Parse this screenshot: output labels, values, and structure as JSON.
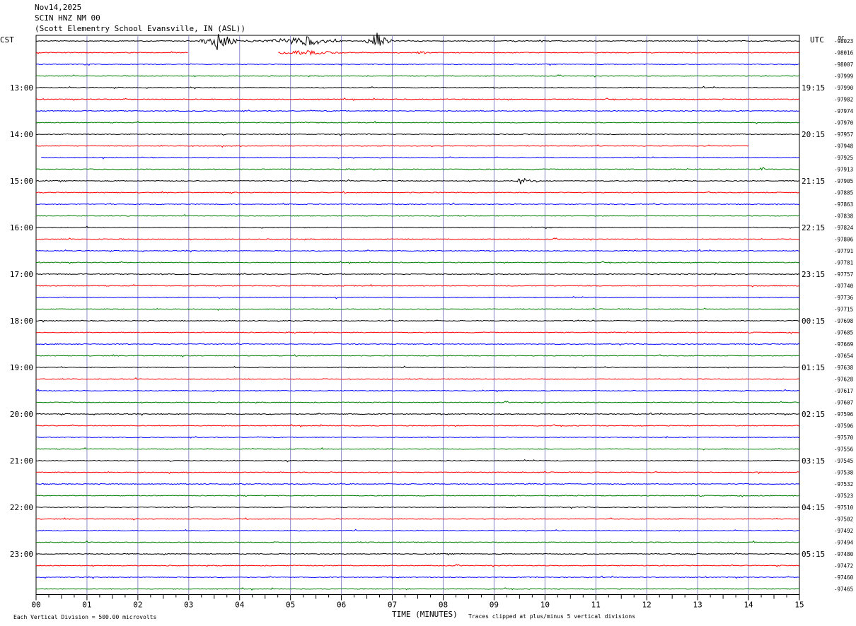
{
  "header": {
    "date": "Nov14,2025",
    "station": "SCIN HNZ NM 00",
    "location": "(Scott Elementry School Evansville, IN (ASL))"
  },
  "footer": {
    "scale_note": "Each Vertical Division =  500.00 microvolts",
    "clip_note": "Traces clipped at plus/minus 5 vertical divisions"
  },
  "chart_data": {
    "type": "line",
    "title": "",
    "xlabel": "TIME (MINUTES)",
    "ylabel": "",
    "xlim": [
      0,
      15
    ],
    "x_ticks": [
      "00",
      "01",
      "02",
      "03",
      "04",
      "05",
      "06",
      "07",
      "08",
      "09",
      "10",
      "11",
      "12",
      "13",
      "14",
      "15"
    ],
    "left_axis_title": "CST",
    "right_axis_title": "UTC",
    "dc_label": "DC",
    "left_time_labels": [
      {
        "row": 4,
        "label": "13:00"
      },
      {
        "row": 8,
        "label": "14:00"
      },
      {
        "row": 12,
        "label": "15:00"
      },
      {
        "row": 16,
        "label": "16:00"
      },
      {
        "row": 20,
        "label": "17:00"
      },
      {
        "row": 24,
        "label": "18:00"
      },
      {
        "row": 28,
        "label": "19:00"
      },
      {
        "row": 32,
        "label": "20:00"
      },
      {
        "row": 36,
        "label": "21:00"
      },
      {
        "row": 40,
        "label": "22:00"
      },
      {
        "row": 44,
        "label": "23:00"
      }
    ],
    "right_time_labels": [
      {
        "row": 4,
        "label": "19:15"
      },
      {
        "row": 8,
        "label": "20:15"
      },
      {
        "row": 12,
        "label": "21:15"
      },
      {
        "row": 16,
        "label": "22:15"
      },
      {
        "row": 20,
        "label": "23:15"
      },
      {
        "row": 24,
        "label": "00:15"
      },
      {
        "row": 28,
        "label": "01:15"
      },
      {
        "row": 32,
        "label": "02:15"
      },
      {
        "row": 36,
        "label": "03:15"
      },
      {
        "row": 40,
        "label": "04:15"
      },
      {
        "row": 44,
        "label": "05:15"
      }
    ],
    "trace_colors": [
      "#000000",
      "#ff0000",
      "#0000ff",
      "#008000"
    ],
    "grid_color": "#8c8cc8",
    "dc_offsets": [
      "-98023",
      "-98016",
      "-98007",
      "-97999",
      "-97990",
      "-97982",
      "-97974",
      "-97970",
      "-97957",
      "-97948",
      "-97925",
      "-97913",
      "-97905",
      "-97885",
      "-97863",
      "-97838",
      "-97824",
      "-97806",
      "-97791",
      "-97781",
      "-97757",
      "-97740",
      "-97736",
      "-97715",
      "-97698",
      "-97685",
      "-97669",
      "-97654",
      "-97638",
      "-97628",
      "-97617",
      "-97607",
      "-97596",
      "-97596",
      "-97570",
      "-97556",
      "-97545",
      "-97538",
      "-97532",
      "-97523",
      "-97510",
      "-97502",
      "-97492",
      "-97494",
      "-97480",
      "-97472",
      "-97460",
      "-97465"
    ],
    "events": [
      {
        "row": 0,
        "start_min": 3.2,
        "end_min": 4.0,
        "peak_min": 3.6,
        "amplitude_div": 5
      },
      {
        "row": 0,
        "start_min": 4.0,
        "end_min": 6.0,
        "peak_min": 5.3,
        "amplitude_div": 2.5
      },
      {
        "row": 0,
        "start_min": 6.4,
        "end_min": 7.0,
        "peak_min": 6.7,
        "amplitude_div": 4
      },
      {
        "row": 1,
        "start_min": 4.0,
        "end_min": 6.0,
        "peak_min": 5.3,
        "amplitude_div": 1.2
      },
      {
        "row": 1,
        "start_min": 7.4,
        "end_min": 7.8,
        "peak_min": 7.6,
        "amplitude_div": 0.8
      },
      {
        "row": 11,
        "start_min": 14.2,
        "end_min": 14.4,
        "peak_min": 14.25,
        "amplitude_div": 1.5
      },
      {
        "row": 12,
        "start_min": 9.45,
        "end_min": 9.9,
        "peak_min": 9.55,
        "amplitude_div": 2.5
      }
    ],
    "gaps": [
      {
        "row": 1,
        "start_min": 3.0,
        "end_min": 4.75
      },
      {
        "row": 9,
        "start_min": 14.0,
        "end_min": 15.0
      },
      {
        "row": 10,
        "start_min": 0.0,
        "end_min": 0.1
      }
    ]
  }
}
